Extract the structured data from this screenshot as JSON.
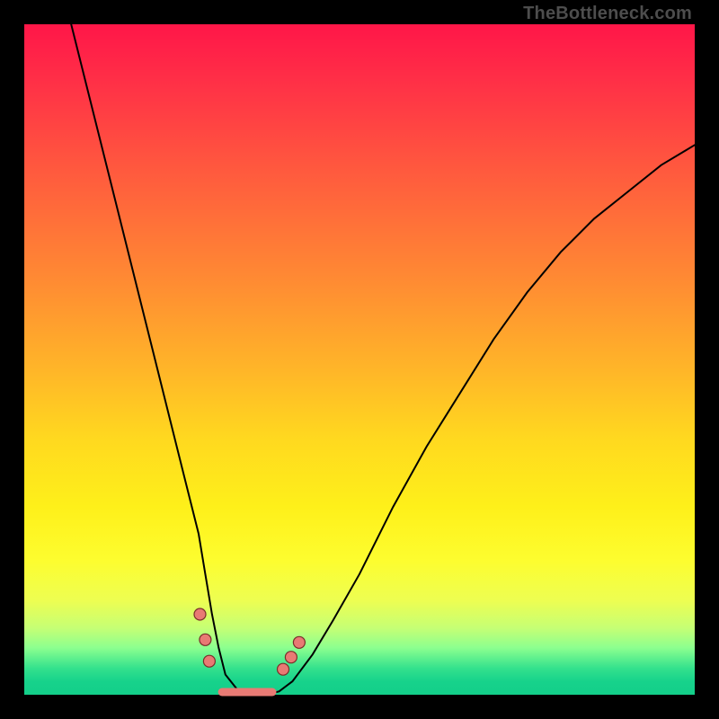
{
  "watermark": "TheBottleneck.com",
  "chart_data": {
    "type": "line",
    "title": "",
    "xlabel": "",
    "ylabel": "",
    "xlim": [
      0,
      100
    ],
    "ylim": [
      0,
      100
    ],
    "grid": false,
    "legend": false,
    "background_gradient": {
      "top": "#ff1648",
      "mid": "#ffd91f",
      "bottom": "#13cf8a"
    },
    "series": [
      {
        "name": "curve",
        "x": [
          7,
          10,
          13,
          16,
          18,
          20,
          22,
          24,
          26,
          27,
          28,
          29,
          30,
          32,
          34,
          36,
          38,
          40,
          43,
          46,
          50,
          55,
          60,
          65,
          70,
          75,
          80,
          85,
          90,
          95,
          100
        ],
        "y": [
          100,
          88,
          76,
          64,
          56,
          48,
          40,
          32,
          24,
          18,
          12,
          7,
          3,
          0.5,
          0,
          0,
          0.5,
          2,
          6,
          11,
          18,
          28,
          37,
          45,
          53,
          60,
          66,
          71,
          75,
          79,
          82
        ]
      }
    ],
    "markers": {
      "name": "highlighted-points",
      "color": "#e87a74",
      "points": [
        {
          "x": 26.2,
          "y": 12.0
        },
        {
          "x": 27.0,
          "y": 8.2
        },
        {
          "x": 27.6,
          "y": 5.0
        },
        {
          "x": 38.6,
          "y": 3.8
        },
        {
          "x": 39.8,
          "y": 5.6
        },
        {
          "x": 41.0,
          "y": 7.8
        }
      ]
    },
    "valley_segment": {
      "name": "valley-flat",
      "color": "#e87a74",
      "x_start": 29.5,
      "x_end": 37.0,
      "y": 0.4
    }
  }
}
